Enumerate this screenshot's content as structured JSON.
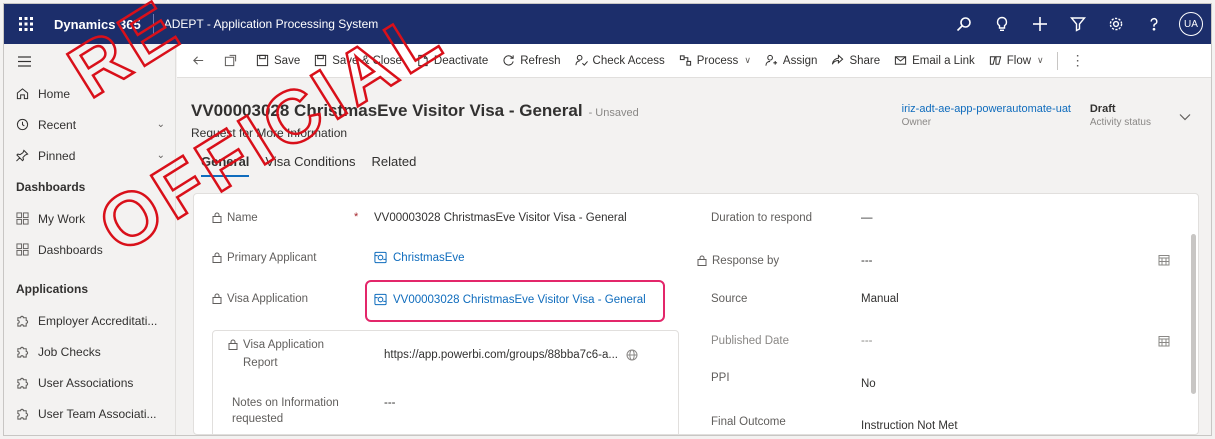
{
  "topbar": {
    "brand": "Dynamics 365",
    "app_name": "ADEPT - Application Processing System",
    "avatar": "UA",
    "icons": [
      "search-icon",
      "lightbulb-icon",
      "plus-icon",
      "filter-icon",
      "gear-icon",
      "help-icon"
    ]
  },
  "sidebar": {
    "items": [
      {
        "label": "Home",
        "icon": "home-icon"
      },
      {
        "label": "Recent",
        "icon": "clock-icon",
        "chevron": "⌄"
      },
      {
        "label": "Pinned",
        "icon": "pin-icon",
        "chevron": "⌄"
      }
    ],
    "dashboards_header": "Dashboards",
    "dashboards": [
      {
        "label": "My Work",
        "icon": "grid-icon"
      },
      {
        "label": "Dashboards",
        "icon": "grid-icon"
      }
    ],
    "applications_header": "Applications",
    "applications": [
      {
        "label": "Employer Accreditati...",
        "icon": "puzzle-icon"
      },
      {
        "label": "Job Checks",
        "icon": "puzzle-icon"
      },
      {
        "label": "User Associations",
        "icon": "puzzle-icon"
      },
      {
        "label": "User Team Associati...",
        "icon": "puzzle-icon"
      }
    ]
  },
  "commandbar": {
    "save": "Save",
    "save_close": "Save & Close",
    "deactivate": "Deactivate",
    "refresh": "Refresh",
    "check_access": "Check Access",
    "process": "Process",
    "assign": "Assign",
    "share": "Share",
    "email_link": "Email a Link",
    "flow": "Flow"
  },
  "record": {
    "title": "VV00003028 ChristmasEve Visitor Visa - General",
    "unsaved": "- Unsaved",
    "subtitle": "Request for More Information",
    "owner_value": "iriz-adt-ae-app-powerautomate-uat",
    "owner_label": "Owner",
    "status_value": "Draft",
    "status_label": "Activity status"
  },
  "tabs": [
    "General",
    "Visa Conditions",
    "Related"
  ],
  "form": {
    "name_label": "Name",
    "name_value": "VV00003028 ChristmasEve Visitor Visa - General",
    "primary_applicant_label": "Primary Applicant",
    "primary_applicant_value": "ChristmasEve",
    "visa_application_label": "Visa Application",
    "visa_application_value": "VV00003028 ChristmasEve Visitor Visa - General",
    "visa_report_label_1": "Visa Application",
    "visa_report_label_2": "Report",
    "visa_report_value": "https://app.powerbi.com/groups/88bba7c6-a...",
    "notes_label_1": "Notes on Information",
    "notes_label_2": "requested",
    "notes_value": "---",
    "duration_label": "Duration to respond",
    "duration_value": "—",
    "response_by_label": "Response by",
    "response_by_value": "---",
    "source_label": "Source",
    "source_value": "Manual",
    "published_label": "Published Date",
    "published_value": "---",
    "ppi_label": "PPI",
    "ppi_value": "No",
    "final_outcome_label": "Final Outcome",
    "final_outcome_value": "Instruction Not Met"
  },
  "watermark": "OFFICIAL",
  "colors": {
    "topbar": "#1c2e6b",
    "link": "#0f6cbd",
    "highlight": "#e3266a",
    "watermark": "#d9101a"
  }
}
